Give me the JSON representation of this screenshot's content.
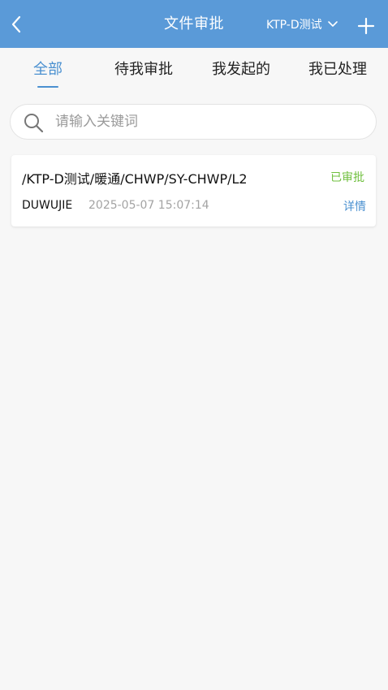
{
  "header": {
    "title": "文件审批",
    "back_icon": "chevron-left-icon",
    "project_label": "KTP-D测试",
    "project_chevron_icon": "chevron-down-icon",
    "add_icon": "plus-icon",
    "background_color": "#5a9ad8"
  },
  "tabs": [
    {
      "label": "全部",
      "active": true
    },
    {
      "label": "待我审批",
      "active": false
    },
    {
      "label": "我发起的",
      "active": false
    },
    {
      "label": "我已处理",
      "active": false
    }
  ],
  "search": {
    "placeholder": "请输入关键词",
    "value": ""
  },
  "records": [
    {
      "path": "/KTP-D测试/暖通/CHWP/SY-CHWP/L2",
      "status": "已审批",
      "status_color": "#6fbf3e",
      "user": "DUWUJIE",
      "time": "2025-05-07 15:07:14",
      "detail_label": "详情"
    }
  ],
  "colors": {
    "accent": "#4a90d0",
    "page_background": "#f7f7f7"
  }
}
